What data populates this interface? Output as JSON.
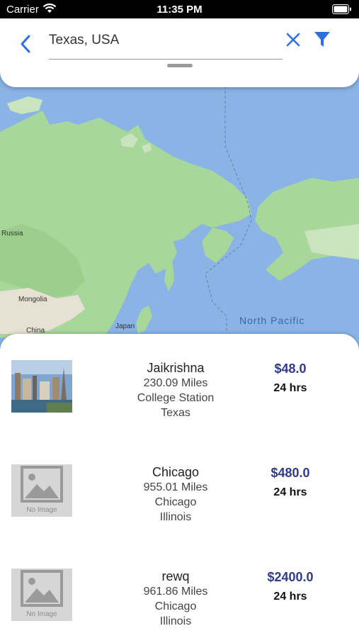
{
  "status_bar": {
    "carrier": "Carrier",
    "time": "11:35 PM"
  },
  "search": {
    "query": "Texas, USA",
    "back_icon": "chevron-left-icon",
    "clear_icon": "close-icon",
    "filter_icon": "filter-icon",
    "accent_color": "#2f6fe0"
  },
  "map": {
    "labels": [
      "Russia",
      "Mongolia",
      "China",
      "Japan",
      "North Pacific"
    ]
  },
  "listings": [
    {
      "name": "Jaikrishna",
      "distance": "230.09 Miles",
      "city": "College Station",
      "state": "Texas",
      "price": "$48.0",
      "duration": "24 hrs",
      "image": "photo"
    },
    {
      "name": "Chicago",
      "distance": "955.01 Miles",
      "city": "Chicago",
      "state": "Illinois",
      "price": "$480.0",
      "duration": "24 hrs",
      "image": "No Image"
    },
    {
      "name": "rewq",
      "distance": "961.86 Miles",
      "city": "Chicago",
      "state": "Illinois",
      "price": "$2400.0",
      "duration": "24 hrs",
      "image": "No Image"
    }
  ],
  "colors": {
    "price": "#2e3a8c",
    "water": "#8ab3e6",
    "land": "#a7d79a"
  }
}
